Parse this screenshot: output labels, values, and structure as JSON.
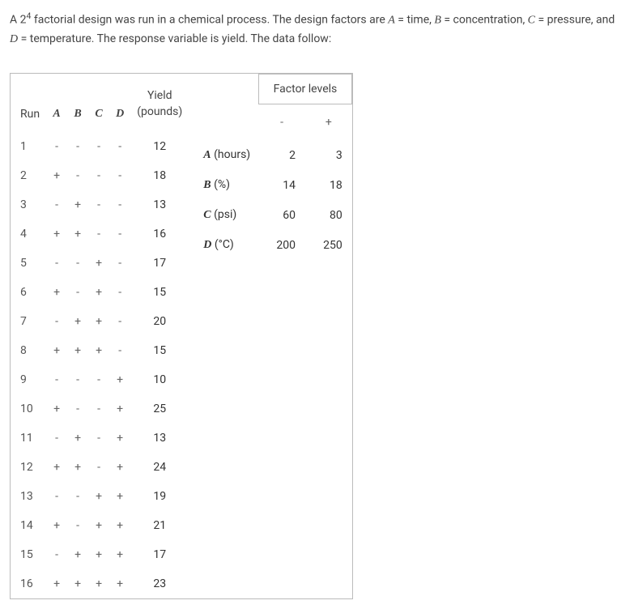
{
  "intro": {
    "text_parts": [
      "A 2",
      "4",
      " factorial design was run in a chemical process. The design factors are ",
      "A",
      " = time, ",
      "B",
      " = concentration, ",
      "C",
      " = pressure, and ",
      "D",
      " = temperature. The response variable is yield. The data follow:"
    ]
  },
  "headers": {
    "run": "Run",
    "A": "A",
    "B": "B",
    "C": "C",
    "D": "D",
    "yield_line1": "Yield",
    "yield_line2": "(pounds)",
    "factor_levels": "Factor levels",
    "minus": "-",
    "plus": "+"
  },
  "rows": [
    {
      "run": "1",
      "A": "-",
      "B": "-",
      "C": "-",
      "D": "-",
      "yield": "12"
    },
    {
      "run": "2",
      "A": "+",
      "B": "-",
      "C": "-",
      "D": "-",
      "yield": "18"
    },
    {
      "run": "3",
      "A": "-",
      "B": "+",
      "C": "-",
      "D": "-",
      "yield": "13"
    },
    {
      "run": "4",
      "A": "+",
      "B": "+",
      "C": "-",
      "D": "-",
      "yield": "16"
    },
    {
      "run": "5",
      "A": "-",
      "B": "-",
      "C": "+",
      "D": "-",
      "yield": "17"
    },
    {
      "run": "6",
      "A": "+",
      "B": "-",
      "C": "+",
      "D": "-",
      "yield": "15"
    },
    {
      "run": "7",
      "A": "-",
      "B": "+",
      "C": "+",
      "D": "-",
      "yield": "20"
    },
    {
      "run": "8",
      "A": "+",
      "B": "+",
      "C": "+",
      "D": "-",
      "yield": "15"
    },
    {
      "run": "9",
      "A": "-",
      "B": "-",
      "C": "-",
      "D": "+",
      "yield": "10"
    },
    {
      "run": "10",
      "A": "+",
      "B": "-",
      "C": "-",
      "D": "+",
      "yield": "25"
    },
    {
      "run": "11",
      "A": "-",
      "B": "+",
      "C": "-",
      "D": "+",
      "yield": "13"
    },
    {
      "run": "12",
      "A": "+",
      "B": "+",
      "C": "-",
      "D": "+",
      "yield": "24"
    },
    {
      "run": "13",
      "A": "-",
      "B": "-",
      "C": "+",
      "D": "+",
      "yield": "19"
    },
    {
      "run": "14",
      "A": "+",
      "B": "-",
      "C": "+",
      "D": "+",
      "yield": "21"
    },
    {
      "run": "15",
      "A": "-",
      "B": "+",
      "C": "+",
      "D": "+",
      "yield": "17"
    },
    {
      "run": "16",
      "A": "+",
      "B": "+",
      "C": "+",
      "D": "+",
      "yield": "23"
    }
  ],
  "factor_levels": [
    {
      "name": "A",
      "unit": "(hours)",
      "low": "2",
      "high": "3"
    },
    {
      "name": "B",
      "unit": "(%)",
      "low": "14",
      "high": "18"
    },
    {
      "name": "C",
      "unit": "(psi)",
      "low": "60",
      "high": "80"
    },
    {
      "name": "D",
      "unit": "(°C)",
      "low": "200",
      "high": "250"
    }
  ]
}
